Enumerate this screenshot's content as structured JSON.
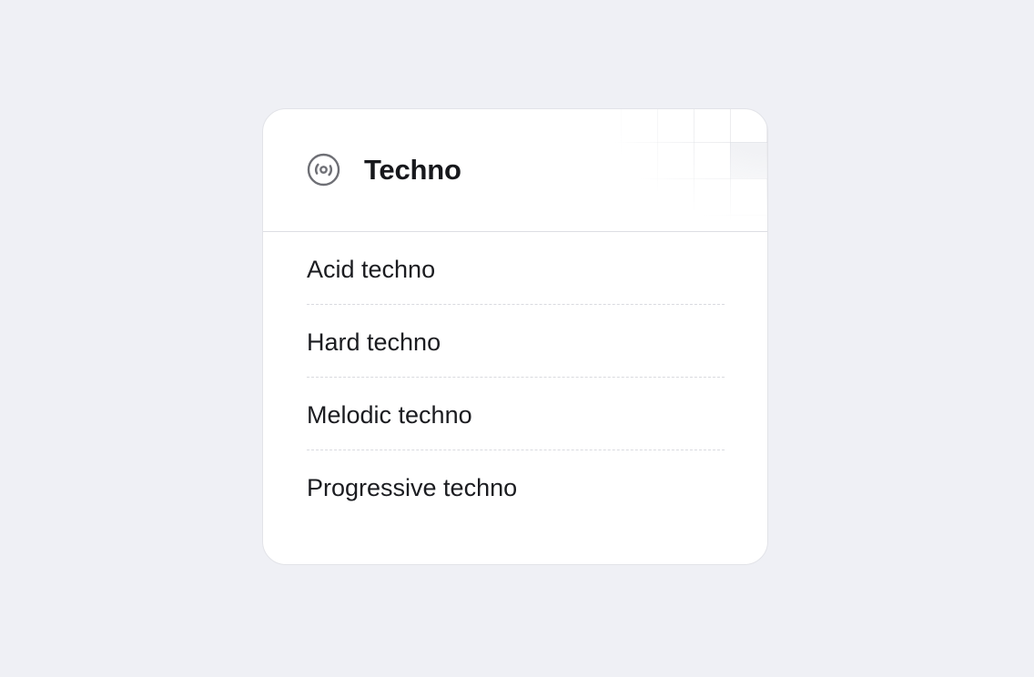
{
  "card": {
    "title": "Techno",
    "icon": "vinyl-disc-icon",
    "items": [
      {
        "label": "Acid techno"
      },
      {
        "label": "Hard techno"
      },
      {
        "label": "Melodic techno"
      },
      {
        "label": "Progressive techno"
      }
    ]
  },
  "colors": {
    "background": "#eff0f5",
    "card": "#ffffff",
    "text": "#17181c",
    "icon": "#6e6f75",
    "divider": "#d9dadf"
  }
}
